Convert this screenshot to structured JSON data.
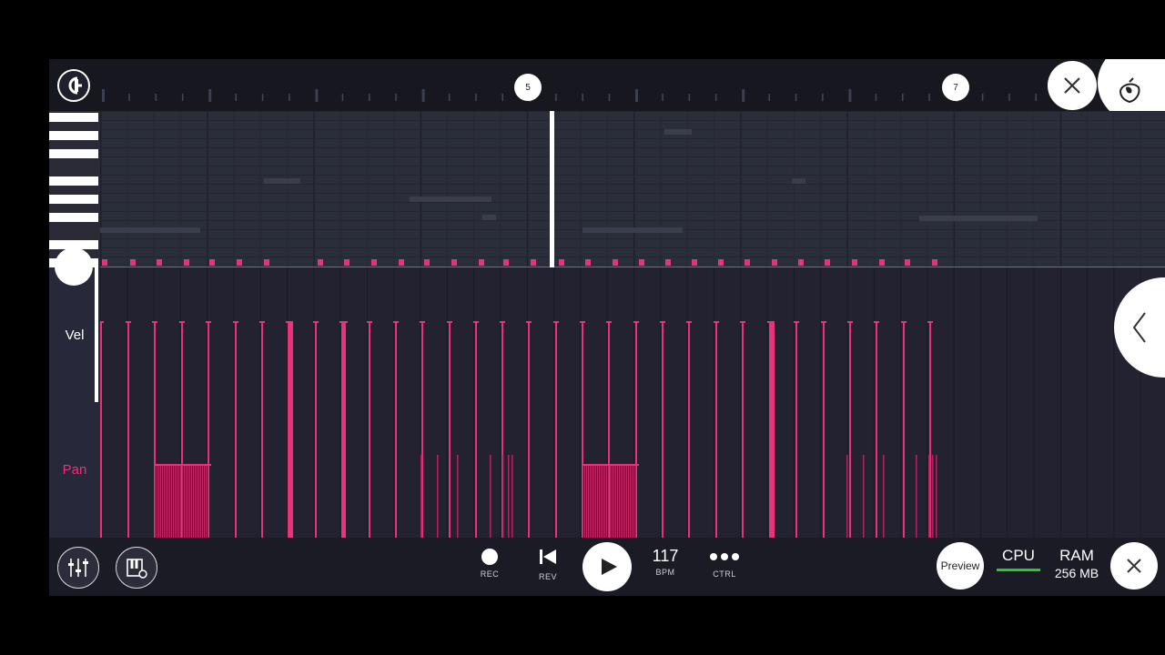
{
  "ruler": {
    "markers": [
      "5",
      "7"
    ]
  },
  "panel": {
    "vel_label": "Vel",
    "pan_label": "Pan"
  },
  "transport": {
    "rec_label": "REC",
    "rev_label": "REV",
    "tempo_value": "117",
    "tempo_label": "BPM",
    "ctrl_label": "CTRL",
    "preview_label": "Preview",
    "cpu_label": "CPU",
    "ram_label": "RAM",
    "ram_value": "256 MB"
  },
  "icons": {
    "magnet": "magnet-icon",
    "close": "close-icon",
    "logo": "fl-fruit-logo",
    "collapse": "chevron-left-icon",
    "mixer": "mixer-icon",
    "piano_settings": "piano-settings-icon",
    "play": "play-icon",
    "rev": "skip-back-icon"
  },
  "colors": {
    "accent": "#e8337a",
    "cpu_meter": "#22cc33",
    "background": "#1f1f2e"
  }
}
